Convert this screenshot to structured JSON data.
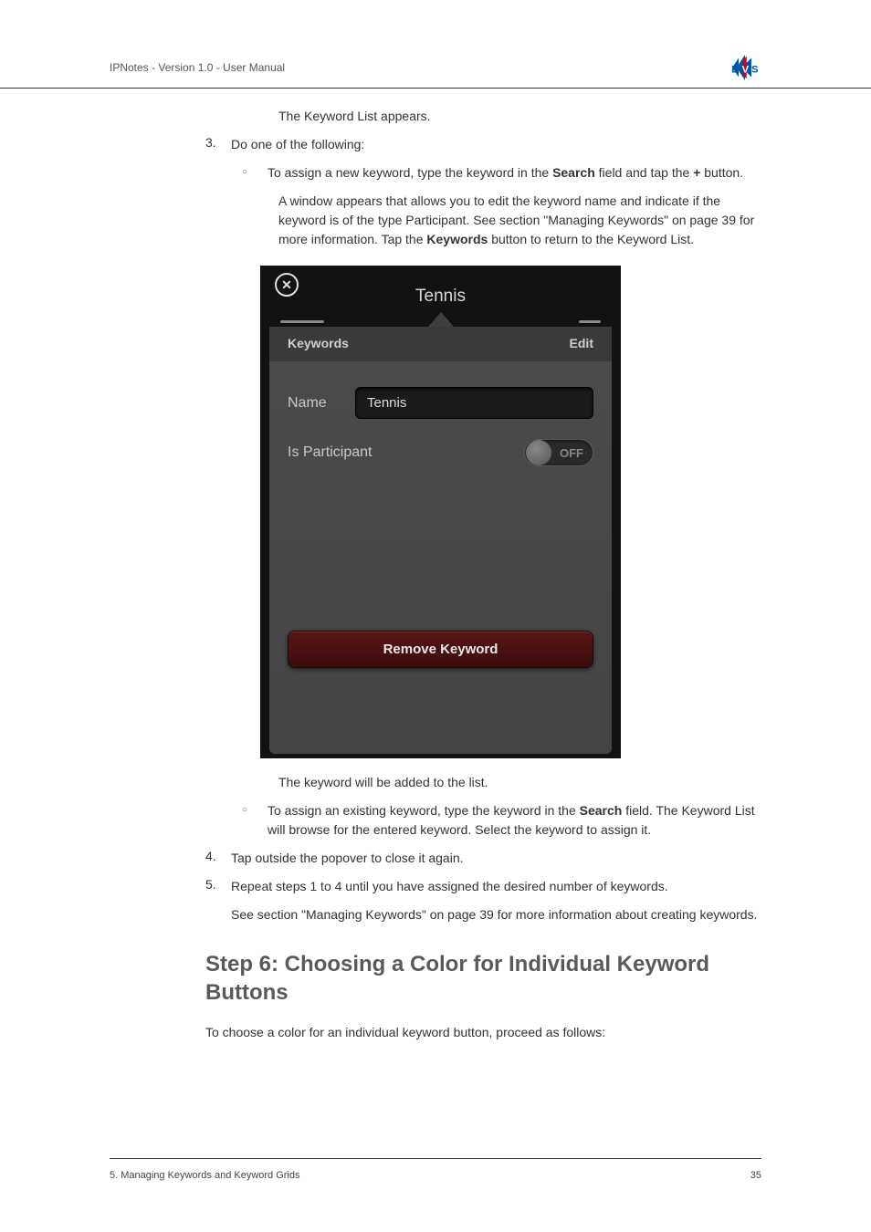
{
  "header": {
    "product": "IPNotes - Version 1.0 - User Manual"
  },
  "intro": {
    "text1": "The Keyword List appears."
  },
  "step3": {
    "num": "3.",
    "text": "Do one of the following:",
    "bullet1a": "To assign a new keyword, type the keyword in the ",
    "bullet1b": "Search",
    "bullet1c": " field and tap the ",
    "bullet1d": "+",
    "bullet1e": " button.",
    "para2a": "A window appears that allows you to edit the keyword name and indicate if the keyword is of the type Participant. See section \"Managing Keywords\" on page 39 for more information. Tap the ",
    "para2b": "Keywords",
    "para2c": " button to return to the Keyword List.",
    "after_img": "The keyword will be added to the list.",
    "bullet2a": "To assign an existing keyword, type the keyword in the ",
    "bullet2b": "Search",
    "bullet2c": " field. The Keyword List will browse for the entered keyword. Select the keyword to assign it."
  },
  "popover": {
    "title": "Tennis",
    "tab_keywords": "Keywords",
    "tab_edit": "Edit",
    "name_label": "Name",
    "name_value": "Tennis",
    "participant_label": "Is Participant",
    "toggle_state": "OFF",
    "remove_label": "Remove Keyword"
  },
  "step4": {
    "num": "4.",
    "text": "Tap outside the popover to close it again."
  },
  "step5": {
    "num": "5.",
    "text": "Repeat steps 1 to 4 until you have assigned the desired number of keywords.",
    "after": "See section \"Managing Keywords\" on page 39 for more information about creating keywords."
  },
  "heading": "Step 6: Choosing a Color for Individual Keyword Buttons",
  "step6_intro": "To choose a color for an individual keyword button, proceed as follows:",
  "footer": {
    "section": "5. Managing Keywords and Keyword Grids",
    "page": "35"
  }
}
